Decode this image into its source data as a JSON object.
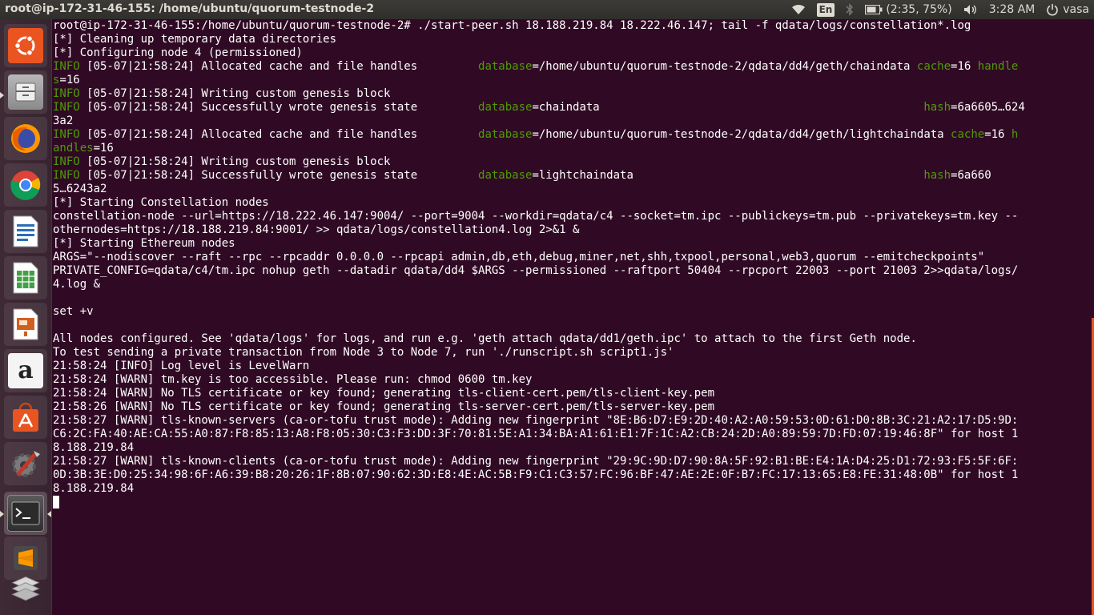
{
  "window": {
    "title": "root@ip-172-31-46-155: /home/ubuntu/quorum-testnode-2"
  },
  "panel": {
    "keyboard_layout": "En",
    "battery": "(2:35, 75%)",
    "clock": "3:28 AM",
    "user": "vasa",
    "icons": [
      "wifi-icon",
      "bluetooth-icon",
      "battery-icon",
      "volume-icon",
      "power-icon"
    ]
  },
  "launcher": {
    "items": [
      {
        "name": "ubuntu-dash-icon",
        "color": "#e95420"
      },
      {
        "name": "files-icon",
        "color": "#9a9a9a"
      },
      {
        "name": "firefox-icon",
        "color": "#e66000"
      },
      {
        "name": "chrome-icon",
        "color": "#4285f4"
      },
      {
        "name": "libreoffice-writer-icon",
        "color": "#2a6fb5"
      },
      {
        "name": "libreoffice-calc-icon",
        "color": "#3c9a3c"
      },
      {
        "name": "libreoffice-impress-icon",
        "color": "#c55a1b"
      },
      {
        "name": "amazon-icon",
        "color": "#ffffff"
      },
      {
        "name": "software-center-icon",
        "color": "#e95420"
      },
      {
        "name": "system-settings-icon",
        "color": "#888888"
      },
      {
        "name": "terminal-icon",
        "color": "#333333"
      },
      {
        "name": "sublime-text-icon",
        "color": "#ff9800"
      },
      {
        "name": "workspaces-icon",
        "color": "#bbbbbb"
      }
    ]
  },
  "terminal": {
    "lines": [
      {
        "segments": [
          {
            "text": "root@ip-172-31-46-155:/home/ubuntu/quorum-testnode-2# ./start-peer.sh 18.188.219.84 18.222.46.147; tail -f qdata/logs/constellation*.log",
            "style": "plain"
          }
        ]
      },
      {
        "segments": [
          {
            "text": "[*] Cleaning up temporary data directories",
            "style": "plain"
          }
        ]
      },
      {
        "segments": [
          {
            "text": "[*] Configuring node 4 (permissioned)",
            "style": "plain"
          }
        ]
      },
      {
        "segments": [
          {
            "text": "INFO",
            "style": "info"
          },
          {
            "text": " [05-07|21:58:24] Allocated cache and file handles         ",
            "style": "plain"
          },
          {
            "text": "database",
            "style": "key"
          },
          {
            "text": "=/home/ubuntu/quorum-testnode-2/qdata/dd4/geth/chaindata ",
            "style": "plain"
          },
          {
            "text": "cache",
            "style": "key"
          },
          {
            "text": "=16 ",
            "style": "plain"
          },
          {
            "text": "handle",
            "style": "key"
          }
        ]
      },
      {
        "segments": [
          {
            "text": "s",
            "style": "key"
          },
          {
            "text": "=16",
            "style": "plain"
          }
        ]
      },
      {
        "segments": [
          {
            "text": "INFO",
            "style": "info"
          },
          {
            "text": " [05-07|21:58:24] Writing custom genesis block",
            "style": "plain"
          }
        ]
      },
      {
        "segments": [
          {
            "text": "INFO",
            "style": "info"
          },
          {
            "text": " [05-07|21:58:24] Successfully wrote genesis state         ",
            "style": "plain"
          },
          {
            "text": "database",
            "style": "key"
          },
          {
            "text": "=chaindata                                                ",
            "style": "plain"
          },
          {
            "text": "hash",
            "style": "key"
          },
          {
            "text": "=6a6605…624",
            "style": "plain"
          }
        ]
      },
      {
        "segments": [
          {
            "text": "3a2",
            "style": "plain"
          }
        ]
      },
      {
        "segments": [
          {
            "text": "INFO",
            "style": "info"
          },
          {
            "text": " [05-07|21:58:24] Allocated cache and file handles         ",
            "style": "plain"
          },
          {
            "text": "database",
            "style": "key"
          },
          {
            "text": "=/home/ubuntu/quorum-testnode-2/qdata/dd4/geth/lightchaindata ",
            "style": "plain"
          },
          {
            "text": "cache",
            "style": "key"
          },
          {
            "text": "=16 ",
            "style": "plain"
          },
          {
            "text": "h",
            "style": "key"
          }
        ]
      },
      {
        "segments": [
          {
            "text": "andles",
            "style": "key"
          },
          {
            "text": "=16",
            "style": "plain"
          }
        ]
      },
      {
        "segments": [
          {
            "text": "INFO",
            "style": "info"
          },
          {
            "text": " [05-07|21:58:24] Writing custom genesis block",
            "style": "plain"
          }
        ]
      },
      {
        "segments": [
          {
            "text": "INFO",
            "style": "info"
          },
          {
            "text": " [05-07|21:58:24] Successfully wrote genesis state         ",
            "style": "plain"
          },
          {
            "text": "database",
            "style": "key"
          },
          {
            "text": "=lightchaindata                                           ",
            "style": "plain"
          },
          {
            "text": "hash",
            "style": "key"
          },
          {
            "text": "=6a660",
            "style": "plain"
          }
        ]
      },
      {
        "segments": [
          {
            "text": "5…6243a2",
            "style": "plain"
          }
        ]
      },
      {
        "segments": [
          {
            "text": "[*] Starting Constellation nodes",
            "style": "plain"
          }
        ]
      },
      {
        "segments": [
          {
            "text": "constellation-node --url=https://18.222.46.147:9004/ --port=9004 --workdir=qdata/c4 --socket=tm.ipc --publickeys=tm.pub --privatekeys=tm.key --",
            "style": "plain"
          }
        ]
      },
      {
        "segments": [
          {
            "text": "othernodes=https://18.188.219.84:9001/ >> qdata/logs/constellation4.log 2>&1 &",
            "style": "plain"
          }
        ]
      },
      {
        "segments": [
          {
            "text": "[*] Starting Ethereum nodes",
            "style": "plain"
          }
        ]
      },
      {
        "segments": [
          {
            "text": "ARGS=\"--nodiscover --raft --rpc --rpcaddr 0.0.0.0 --rpcapi admin,db,eth,debug,miner,net,shh,txpool,personal,web3,quorum --emitcheckpoints\"",
            "style": "plain"
          }
        ]
      },
      {
        "segments": [
          {
            "text": "PRIVATE_CONFIG=qdata/c4/tm.ipc nohup geth --datadir qdata/dd4 $ARGS --permissioned --raftport 50404 --rpcport 22003 --port 21003 2>>qdata/logs/",
            "style": "plain"
          }
        ]
      },
      {
        "segments": [
          {
            "text": "4.log &",
            "style": "plain"
          }
        ]
      },
      {
        "segments": [
          {
            "text": "",
            "style": "plain"
          }
        ]
      },
      {
        "segments": [
          {
            "text": "set +v",
            "style": "plain"
          }
        ]
      },
      {
        "segments": [
          {
            "text": "",
            "style": "plain"
          }
        ]
      },
      {
        "segments": [
          {
            "text": "All nodes configured. See 'qdata/logs' for logs, and run e.g. 'geth attach qdata/dd1/geth.ipc' to attach to the first Geth node.",
            "style": "plain"
          }
        ]
      },
      {
        "segments": [
          {
            "text": "To test sending a private transaction from Node 3 to Node 7, run './runscript.sh script1.js'",
            "style": "plain"
          }
        ]
      },
      {
        "segments": [
          {
            "text": "21:58:24 [INFO] Log level is LevelWarn",
            "style": "plain"
          }
        ]
      },
      {
        "segments": [
          {
            "text": "21:58:24 [WARN] tm.key is too accessible. Please run: chmod 0600 tm.key",
            "style": "plain"
          }
        ]
      },
      {
        "segments": [
          {
            "text": "21:58:24 [WARN] No TLS certificate or key found; generating tls-client-cert.pem/tls-client-key.pem",
            "style": "plain"
          }
        ]
      },
      {
        "segments": [
          {
            "text": "21:58:26 [WARN] No TLS certificate or key found; generating tls-server-cert.pem/tls-server-key.pem",
            "style": "plain"
          }
        ]
      },
      {
        "segments": [
          {
            "text": "21:58:27 [WARN] tls-known-servers (ca-or-tofu trust mode): Adding new fingerprint \"8E:B6:D7:E9:2D:40:A2:A0:59:53:0D:61:D0:8B:3C:21:A2:17:D5:9D:",
            "style": "plain"
          }
        ]
      },
      {
        "segments": [
          {
            "text": "C6:2C:FA:40:AE:CA:55:A0:87:F8:85:13:A8:F8:05:30:C3:F3:DD:3F:70:81:5E:A1:34:BA:A1:61:E1:7F:1C:A2:CB:24:2D:A0:89:59:7D:FD:07:19:46:8F\" for host 1",
            "style": "plain"
          }
        ]
      },
      {
        "segments": [
          {
            "text": "8.188.219.84",
            "style": "plain"
          }
        ]
      },
      {
        "segments": [
          {
            "text": "21:58:27 [WARN] tls-known-clients (ca-or-tofu trust mode): Adding new fingerprint \"29:9C:9D:D7:90:8A:5F:92:B1:BE:E4:1A:D4:25:D1:72:93:F5:5F:6F:",
            "style": "plain"
          }
        ]
      },
      {
        "segments": [
          {
            "text": "0D:3B:3E:D0:25:34:98:6F:A6:39:B8:20:26:1F:8B:07:90:62:3D:E8:4E:AC:5B:F9:C1:C3:57:FC:96:BF:47:AE:2E:0F:B7:FC:17:13:65:E8:FE:31:48:0B\" for host 1",
            "style": "plain"
          }
        ]
      },
      {
        "segments": [
          {
            "text": "8.188.219.84",
            "style": "plain"
          }
        ]
      }
    ]
  }
}
